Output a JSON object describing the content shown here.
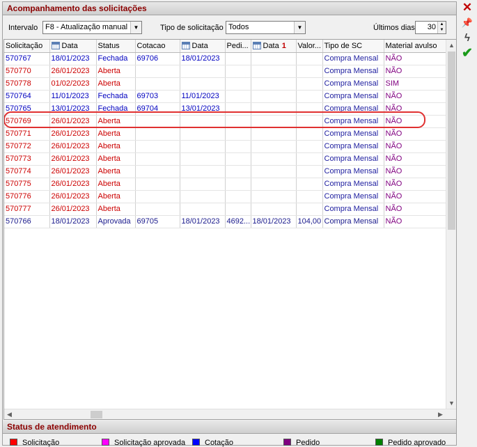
{
  "panel_title": "Acompanhamento das solicitações",
  "filters": {
    "intervalo_label": "Intervalo",
    "intervalo_value": "F8 - Atualização manual",
    "tipo_label": "Tipo de solicitação",
    "tipo_value": "Todos",
    "dias_label": "Últimos dias",
    "dias_value": "30"
  },
  "columns": [
    "Solicitação",
    "Data",
    "Status",
    "Cotacao",
    "Data",
    "Pedi...",
    "Data",
    "Valor...",
    "Tipo de SC",
    "Material avulso"
  ],
  "colors": {
    "solicitacao": "#ff0000",
    "solicitacao_aprovada": "#ff00ff",
    "cotacao": "#0000ff",
    "pedido": "#800080",
    "pedido_aprovado": "#008000",
    "highlight": "#e03030",
    "title": "#8b0000"
  },
  "rows": [
    {
      "cells": [
        "570767",
        "18/01/2023",
        "Fechada",
        "69706",
        "18/01/2023",
        "",
        "",
        "",
        "Compra Mensal",
        "NÃO"
      ],
      "color": "#0000c0"
    },
    {
      "cells": [
        "570770",
        "26/01/2023",
        "Aberta",
        "",
        "",
        "",
        "",
        "",
        "Compra Mensal",
        "NÃO"
      ],
      "color": "#cc0000"
    },
    {
      "cells": [
        "570778",
        "01/02/2023",
        "Aberta",
        "",
        "",
        "",
        "",
        "",
        "Compra Mensal",
        "SIM"
      ],
      "color": "#cc0000"
    },
    {
      "cells": [
        "570764",
        "11/01/2023",
        "Fechada",
        "69703",
        "11/01/2023",
        "",
        "",
        "",
        "Compra Mensal",
        "NÃO"
      ],
      "color": "#0000c0"
    },
    {
      "cells": [
        "570765",
        "13/01/2023",
        "Fechada",
        "69704",
        "13/01/2023",
        "",
        "",
        "",
        "Compra Mensal",
        "NÃO"
      ],
      "color": "#0000c0"
    },
    {
      "cells": [
        "570769",
        "26/01/2023",
        "Aberta",
        "",
        "",
        "",
        "",
        "",
        "Compra Mensal",
        "NÃO"
      ],
      "color": "#cc0000"
    },
    {
      "cells": [
        "570771",
        "26/01/2023",
        "Aberta",
        "",
        "",
        "",
        "",
        "",
        "Compra Mensal",
        "NÃO"
      ],
      "color": "#cc0000"
    },
    {
      "cells": [
        "570772",
        "26/01/2023",
        "Aberta",
        "",
        "",
        "",
        "",
        "",
        "Compra Mensal",
        "NÃO"
      ],
      "color": "#cc0000"
    },
    {
      "cells": [
        "570773",
        "26/01/2023",
        "Aberta",
        "",
        "",
        "",
        "",
        "",
        "Compra Mensal",
        "NÃO"
      ],
      "color": "#cc0000"
    },
    {
      "cells": [
        "570774",
        "26/01/2023",
        "Aberta",
        "",
        "",
        "",
        "",
        "",
        "Compra Mensal",
        "NÃO"
      ],
      "color": "#cc0000"
    },
    {
      "cells": [
        "570775",
        "26/01/2023",
        "Aberta",
        "",
        "",
        "",
        "",
        "",
        "Compra Mensal",
        "NÃO"
      ],
      "color": "#cc0000"
    },
    {
      "cells": [
        "570776",
        "26/01/2023",
        "Aberta",
        "",
        "",
        "",
        "",
        "",
        "Compra Mensal",
        "NÃO"
      ],
      "color": "#cc0000"
    },
    {
      "cells": [
        "570777",
        "26/01/2023",
        "Aberta",
        "",
        "",
        "",
        "",
        "",
        "Compra Mensal",
        "NÃO"
      ],
      "color": "#cc0000"
    },
    {
      "cells": [
        "570766",
        "18/01/2023",
        "Aprovada",
        "69705",
        "18/01/2023",
        "4692...",
        "18/01/2023",
        "104,00",
        "Compra Mensal",
        "NÃO"
      ],
      "color": "#1a1a8c",
      "mixed": true
    }
  ],
  "status_title": "Status de atendimento",
  "legend": [
    {
      "label": "Solicitação",
      "color": "#ff0000"
    },
    {
      "label": "Solicitação aprovada",
      "color": "#ff00ff"
    },
    {
      "label": "Cotação",
      "color": "#0000ff"
    },
    {
      "label": "Pedido",
      "color": "#800080"
    },
    {
      "label": "Pedido aprovado",
      "color": "#008000"
    }
  ],
  "toolbar": {
    "close_icon": "close-icon",
    "pin_icon": "pin-icon",
    "lightning_icon": "lightning-icon",
    "confirm_icon": "checkmark-icon"
  }
}
